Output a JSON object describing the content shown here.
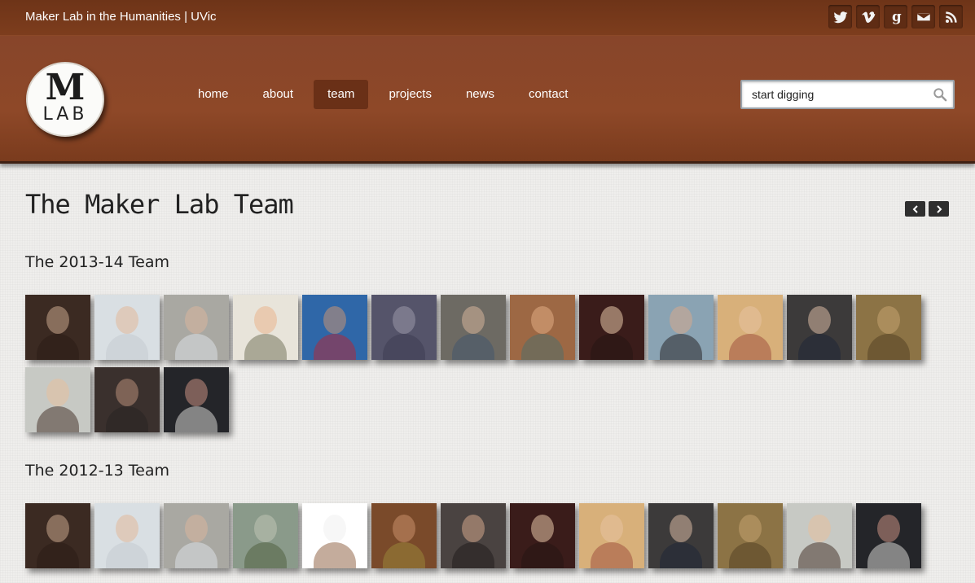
{
  "header": {
    "site_title": "Maker Lab in the Humanities | UVic",
    "social": [
      {
        "icon": "twitter-icon"
      },
      {
        "icon": "vimeo-icon"
      },
      {
        "icon": "goodreads-icon"
      },
      {
        "icon": "mail-icon"
      },
      {
        "icon": "rss-icon"
      }
    ],
    "logo": {
      "top": "M",
      "bottom": "LAB"
    },
    "nav": [
      {
        "label": "home",
        "active": false
      },
      {
        "label": "about",
        "active": false
      },
      {
        "label": "team",
        "active": true
      },
      {
        "label": "projects",
        "active": false
      },
      {
        "label": "news",
        "active": false
      },
      {
        "label": "contact",
        "active": false
      }
    ],
    "search": {
      "value": "start digging",
      "icon": "search-icon"
    }
  },
  "main": {
    "title": "The Maker Lab Team",
    "pager": {
      "prev_icon": "chevron-left-icon",
      "next_icon": "chevron-right-icon"
    },
    "sections": [
      {
        "heading": "The 2013-14 Team",
        "photos": [
          {
            "bg": "#3b2a22",
            "face": "#c9a58c",
            "body": "#2a1a14"
          },
          {
            "bg": "#d9dfe3",
            "face": "#e2b89a",
            "body": "#c4c9cf"
          },
          {
            "bg": "#a9a8a2",
            "face": "#d8b49c",
            "body": "#dfe3ea"
          },
          {
            "bg": "#e8e4da",
            "face": "#e9b58e",
            "body": "#6b6b52"
          },
          {
            "bg": "#2f67a8",
            "face": "#c79373",
            "body": "#b92430"
          },
          {
            "bg": "#55546a",
            "face": "#9b97a8",
            "body": "#3c3a4f"
          },
          {
            "bg": "#6d6a63",
            "face": "#d3b39a",
            "body": "#40536e"
          },
          {
            "bg": "#9d6844",
            "face": "#e0ab84",
            "body": "#4a6d6b"
          },
          {
            "bg": "#3a1c1a",
            "face": "#e6c7a8",
            "body": "#241311"
          },
          {
            "bg": "#8aa3b3",
            "face": "#d6a98c",
            "body": "#1f1b1d"
          },
          {
            "bg": "#d8b07a",
            "face": "#e8c2a0",
            "body": "#9b4a3a"
          },
          {
            "bg": "#3c3a3a",
            "face": "#d7b8a2",
            "body": "#1b2436"
          },
          {
            "bg": "#8c7345",
            "face": "#c4a370",
            "body": "#4f3e22"
          },
          {
            "bg": "#c7c9c4",
            "face": "#e5c09e",
            "body": "#3d2a20"
          },
          {
            "bg": "#3a302d",
            "face": "#b78e78",
            "body": "#262221"
          },
          {
            "bg": "#242529",
            "face": "#c68f82",
            "body": "#e3e3e0"
          }
        ]
      },
      {
        "heading": "The 2012-13 Team",
        "photos": [
          {
            "bg": "#3b2a22",
            "face": "#c9a58c",
            "body": "#2a1a14"
          },
          {
            "bg": "#d9dfe3",
            "face": "#e2b89a",
            "body": "#c4c9cf"
          },
          {
            "bg": "#a9a8a2",
            "face": "#d8b49c",
            "body": "#dfe3ea"
          },
          {
            "bg": "#8a9a8a",
            "face": "#bfc4b4",
            "body": "#4c5c3a"
          },
          {
            "bg": "#ffffff",
            "face": "#f0f0f0",
            "body": "#8a5a3a"
          },
          {
            "bg": "#7a4a2a",
            "face": "#c8906a",
            "body": "#9b8a3a"
          },
          {
            "bg": "#4a4341",
            "face": "#d1a58b",
            "body": "#1e1a19"
          },
          {
            "bg": "#3a1c1a",
            "face": "#e6c7a8",
            "body": "#241311"
          },
          {
            "bg": "#d8b07a",
            "face": "#e8c2a0",
            "body": "#9b4a3a"
          },
          {
            "bg": "#3c3a3a",
            "face": "#d7b8a2",
            "body": "#1b2436"
          },
          {
            "bg": "#8c7345",
            "face": "#c4a370",
            "body": "#4f3e22"
          },
          {
            "bg": "#c7c9c4",
            "face": "#e5c09e",
            "body": "#3d2a20"
          },
          {
            "bg": "#242529",
            "face": "#c68f82",
            "body": "#e3e3e0"
          }
        ]
      }
    ]
  }
}
